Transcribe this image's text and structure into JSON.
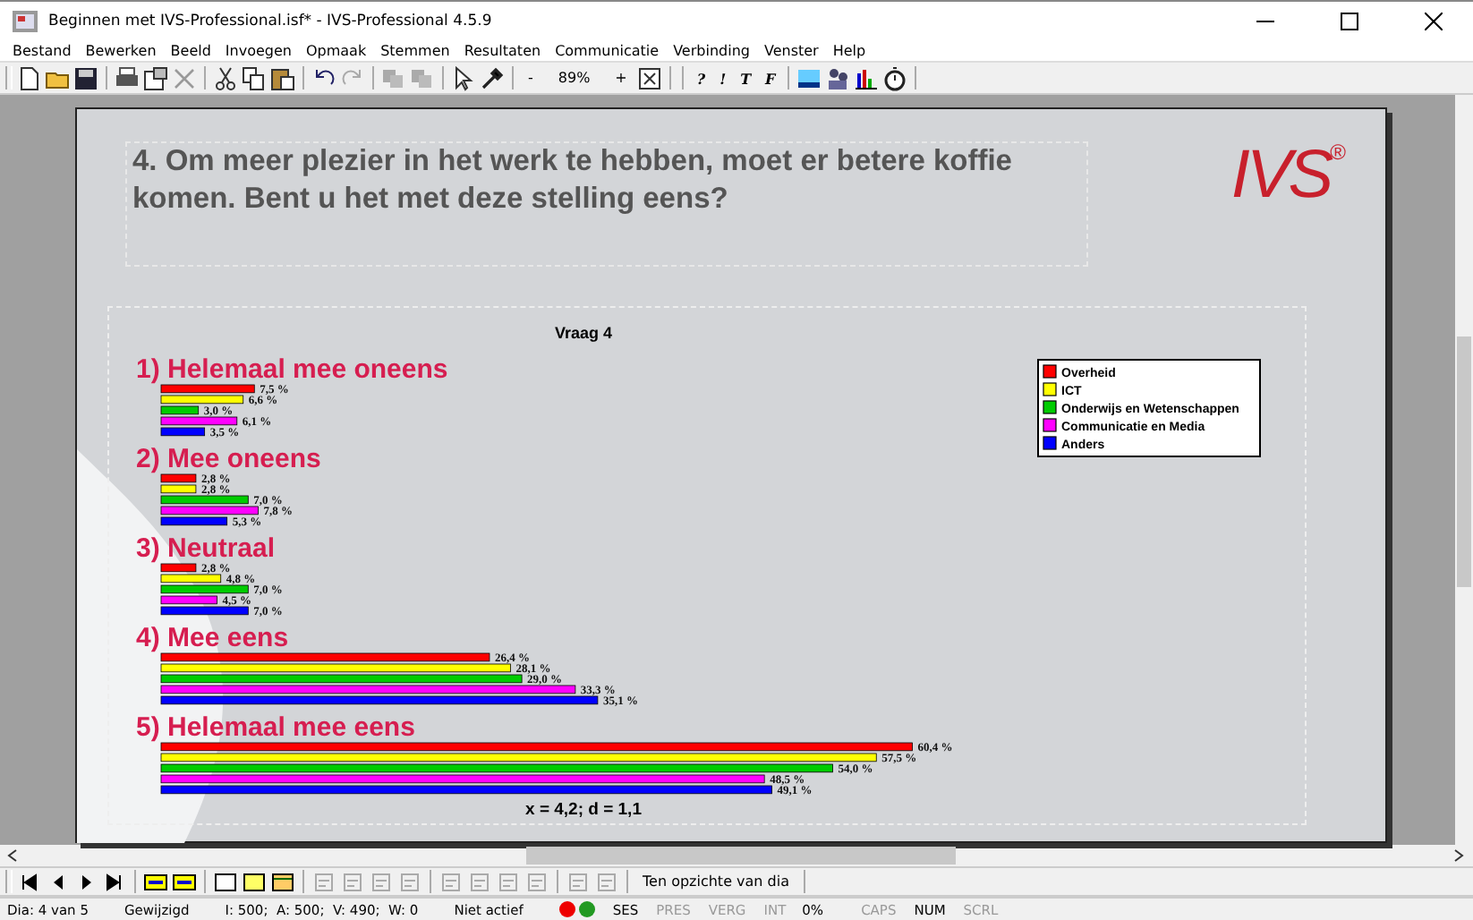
{
  "window": {
    "title": "Beginnen met IVS-Professional.isf* - IVS-Professional 4.5.9"
  },
  "menu": [
    "Bestand",
    "Bewerken",
    "Beeld",
    "Invoegen",
    "Opmaak",
    "Stemmen",
    "Resultaten",
    "Communicatie",
    "Verbinding",
    "Venster",
    "Help"
  ],
  "toolbar": {
    "zoom_out": "-",
    "zoom": "89%",
    "zoom_in": "+",
    "format_buttons": [
      "?",
      "!",
      "T",
      "F"
    ]
  },
  "slide": {
    "title": "4. Om meer plezier in het werk te hebben, moet er betere koffie komen. Bent u het met deze stelling eens?",
    "logo": "IVS$^{®}$",
    "chart_data": {
      "type": "bar",
      "orientation": "horizontal",
      "title": "Vraag 4",
      "categories": [
        "1) Helemaal mee oneens",
        "2) Mee oneens",
        "3) Neutraal",
        "4) Mee eens",
        "5) Helemaal mee eens"
      ],
      "series": [
        {
          "name": "Overheid",
          "color": "#ff0000",
          "values": [
            7.5,
            2.8,
            2.8,
            26.4,
            60.4
          ],
          "value_labels": [
            "7,5 %",
            "2,8 %",
            "2,8 %",
            "26,4 %",
            "60,4 %"
          ]
        },
        {
          "name": "ICT",
          "color": "#ffff00",
          "values": [
            6.6,
            2.8,
            4.8,
            28.1,
            57.5
          ],
          "value_labels": [
            "6,6 %",
            "2,8 %",
            "4,8 %",
            "28,1 %",
            "57,5 %"
          ]
        },
        {
          "name": "Onderwijs en Wetenschappen",
          "color": "#00cc00",
          "values": [
            3.0,
            7.0,
            7.0,
            29.0,
            54.0
          ],
          "value_labels": [
            "3,0 %",
            "7,0 %",
            "7,0 %",
            "29,0 %",
            "54,0 %"
          ]
        },
        {
          "name": "Communicatie en Media",
          "color": "#ff00ff",
          "values": [
            6.1,
            7.8,
            4.5,
            33.3,
            48.5
          ],
          "value_labels": [
            "6,1 %",
            "7,8 %",
            "4,5 %",
            "33,3 %",
            "48,5 %"
          ]
        },
        {
          "name": "Anders",
          "color": "#0000ff",
          "values": [
            3.5,
            5.3,
            7.0,
            35.1,
            49.1
          ],
          "value_labels": [
            "3,5 %",
            "5,3 %",
            "7,0 %",
            "35,1 %",
            "49,1 %"
          ]
        }
      ],
      "legend": true,
      "data_labels": true,
      "annotations": [
        "x = 4,2; d = 1,1"
      ]
    }
  },
  "bottom_toolbar": {
    "button": "Ten opzichte van dia"
  },
  "status_bar": [
    {
      "kind": "text",
      "text": "Dia: 4 van 5"
    },
    {
      "kind": "text",
      "text": "Gewijzigd"
    },
    {
      "kind": "text",
      "text": "I: 500;  A: 500;  V: 490;  W: 0"
    },
    {
      "kind": "text",
      "text": "Niet actief"
    },
    {
      "kind": "dots"
    },
    {
      "kind": "flag",
      "text": "SES",
      "on": true
    },
    {
      "kind": "flag",
      "text": "PRES",
      "on": false
    },
    {
      "kind": "flag",
      "text": "VERG",
      "on": false
    },
    {
      "kind": "flag",
      "text": "INT",
      "on": false
    },
    {
      "kind": "text",
      "text": "0%"
    },
    {
      "kind": "flag",
      "text": "CAPS",
      "on": false
    },
    {
      "kind": "flag",
      "text": "NUM",
      "on": true
    },
    {
      "kind": "flag",
      "text": "SCRL",
      "on": false
    }
  ]
}
